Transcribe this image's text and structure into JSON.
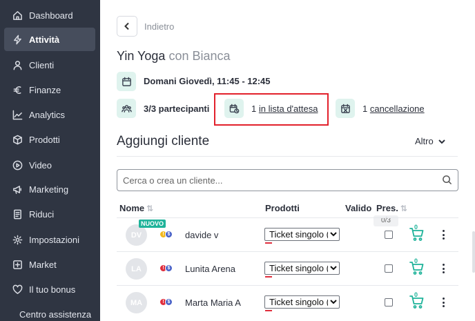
{
  "sidebar": {
    "items": [
      {
        "label": "Dashboard",
        "icon": "home-icon"
      },
      {
        "label": "Attività",
        "icon": "lightning-icon",
        "active": true
      },
      {
        "label": "Clienti",
        "icon": "user-icon"
      },
      {
        "label": "Finanze",
        "icon": "euro-icon"
      },
      {
        "label": "Analytics",
        "icon": "chart-line-icon"
      },
      {
        "label": "Prodotti",
        "icon": "box-icon"
      },
      {
        "label": "Video",
        "icon": "play-icon"
      },
      {
        "label": "Marketing",
        "icon": "megaphone-icon"
      },
      {
        "label": "Riduci",
        "icon": "receipt-icon"
      },
      {
        "label": "Impostazioni",
        "icon": "gear-icon"
      },
      {
        "label": "Market",
        "icon": "plus-square-icon"
      },
      {
        "label": "Il tuo bonus",
        "icon": "heart-icon"
      }
    ],
    "support_label": "Centro assistenza"
  },
  "header": {
    "back_label": "Indietro",
    "class_name": "Yin Yoga",
    "with_label": "con Bianca"
  },
  "info": {
    "schedule": "Domani Giovedì, 11:45 - 12:45",
    "participants": "3/3 partecipanti",
    "waitlist_count": "1",
    "waitlist_label": "in lista d'attesa",
    "cancel_count": "1",
    "cancel_label": "cancellazione"
  },
  "add_client": {
    "title": "Aggiungi cliente",
    "more_label": "Altro",
    "search_placeholder": "Cerca o crea un cliente..."
  },
  "table": {
    "columns": {
      "name": "Nome",
      "products": "Prodotti",
      "valid": "Valido",
      "attendance": "Pres."
    },
    "attendance_count": "0/3",
    "new_badge": "NUOVO",
    "rows": [
      {
        "initials": "DV",
        "name": "davide v",
        "product": "Ticket singolo (1",
        "is_new": true,
        "badges": [
          "yellow",
          "blue"
        ]
      },
      {
        "initials": "LA",
        "name": "Lunita Arena",
        "product": "Ticket singolo (1",
        "is_new": false,
        "badges": [
          "red",
          "blue"
        ]
      },
      {
        "initials": "MA",
        "name": "Marta Maria A",
        "product": "Ticket singolo (1",
        "is_new": false,
        "badges": [
          "red",
          "blue"
        ]
      }
    ],
    "cart_count": "0"
  },
  "colors": {
    "sidebar_bg": "#2f3542",
    "accent": "#1fb39a",
    "highlight_red": "#e2202b"
  }
}
